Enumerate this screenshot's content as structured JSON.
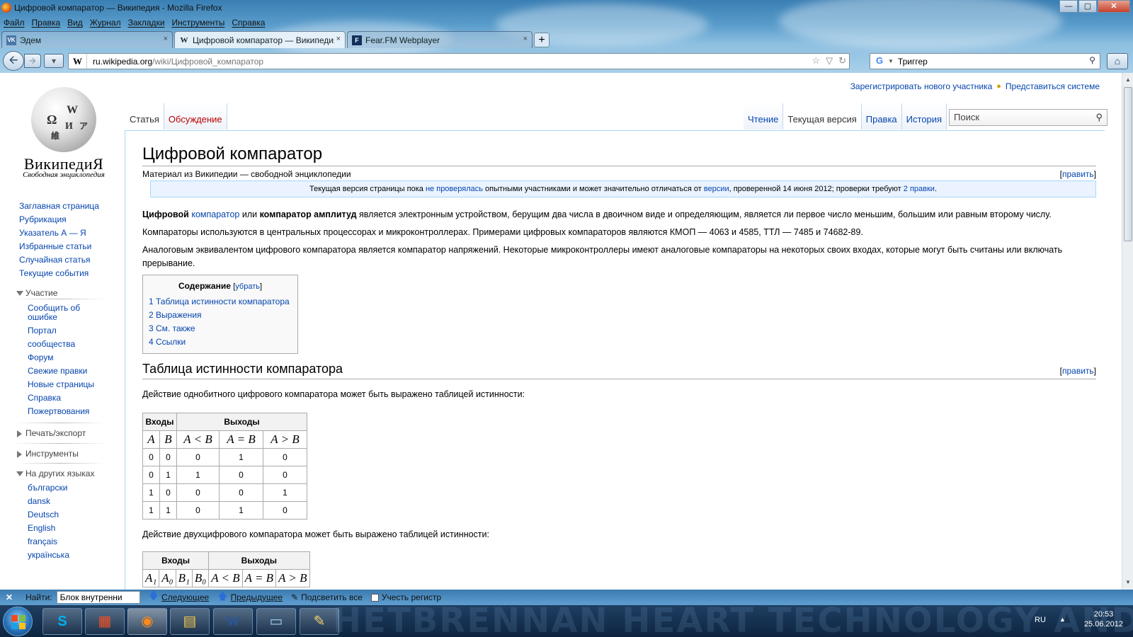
{
  "window": {
    "title": "Цифровой компаратор — Википедия - Mozilla Firefox",
    "controls": {
      "minimize": "—",
      "maximize": "▢",
      "close": "✕"
    }
  },
  "menu": [
    "Файл",
    "Правка",
    "Вид",
    "Журнал",
    "Закладки",
    "Инструменты",
    "Справка"
  ],
  "tabs": [
    {
      "label": "Эдем",
      "favicon": "vk-icon",
      "fav_glyph": "VK",
      "active": false
    },
    {
      "label": "Цифровой компаратор — Википедия",
      "favicon": "wikipedia-icon",
      "fav_glyph": "W",
      "active": true
    },
    {
      "label": "Fear.FM Webplayer",
      "favicon": "fearfm-icon",
      "fav_glyph": "F",
      "active": false
    }
  ],
  "new_tab": "+",
  "tab_close": "×",
  "navbar": {
    "url_domain": "ru.wikipedia.org",
    "url_path": "/wiki/Цифровой_компаратор",
    "url_favicon": "W",
    "search_value": "Триггер",
    "search_engine": "G",
    "back_icon": "back-arrow-icon",
    "forward_icon": "forward-arrow-icon"
  },
  "personal": {
    "register": "Зарегистрировать нового участника",
    "login": "Представиться системе"
  },
  "logo": {
    "title": "ВикипедиЯ",
    "subtitle": "Свободная энциклопедия",
    "glyphs": [
      "Ω",
      "W",
      "И",
      "維",
      "ア"
    ]
  },
  "view_tabs": {
    "left": [
      {
        "label": "Статья",
        "selected": true
      },
      {
        "label": "Обсуждение",
        "selected": false
      }
    ],
    "right": [
      {
        "label": "Чтение",
        "selected": false
      },
      {
        "label": "Текущая версия",
        "selected": true
      },
      {
        "label": "Правка",
        "selected": false
      },
      {
        "label": "История",
        "selected": false
      }
    ]
  },
  "wiki_search": {
    "placeholder": "Поиск"
  },
  "sidebar": {
    "nav": [
      "Заглавная страница",
      "Рубрикация",
      "Указатель А — Я",
      "Избранные статьи",
      "Случайная статья",
      "Текущие события"
    ],
    "participation": {
      "title": "Участие",
      "items": [
        "Сообщить об ошибке",
        "Портал сообщества",
        "Форум",
        "Свежие правки",
        "Новые страницы",
        "Справка",
        "Пожертвования"
      ]
    },
    "print_title": "Печать/экспорт",
    "tools_title": "Инструменты",
    "languages": {
      "title": "На других языках",
      "items": [
        "български",
        "dansk",
        "Deutsch",
        "English",
        "français",
        "українська"
      ]
    }
  },
  "article": {
    "title": "Цифровой компаратор",
    "sitesub": "Материал из Википедии — свободной энциклопедии",
    "edit_label": "править",
    "flagged": {
      "pre": "Текущая версия страницы пока ",
      "link1": "не проверялась",
      "mid": " опытными участниками и может значительно отличаться от ",
      "link2": "версии",
      "post": ", проверенной 14 июня 2012; проверки требуют ",
      "link3": "2 правки",
      "end": "."
    },
    "p1": {
      "b1": "Цифровой",
      "link": "компаратор",
      "t1": " или ",
      "b2": "компаратор амплитуд",
      "t2": " является электронным устройством, берущим два числа в двоичном виде и определяющим, является ли первое число меньшим, большим или равным второму числу."
    },
    "p2": "Компараторы используются в центральных процессорах и микроконтроллерах. Примерами цифровых компараторов являются КМОП — 4063 и 4585, ТТЛ — 7485 и 74682-89.",
    "p3": "Аналоговым эквивалентом цифрового компаратора является компаратор напряжений. Некоторые микроконтроллеры имеют аналоговые компараторы на некоторых своих входах, которые могут быть считаны или включать прерывание.",
    "toc": {
      "title": "Содержание",
      "toggle": "убрать",
      "items": [
        "1 Таблица истинности компаратора",
        "2 Выражения",
        "3 См. также",
        "4 Ссылки"
      ]
    },
    "h2_truth": "Таблица истинности компаратора",
    "p4": "Действие однобитного цифрового компаратора может быть выражено таблицей истинности:",
    "table1": {
      "group_in": "Входы",
      "group_out": "Выходы",
      "cols": [
        "A",
        "B",
        "A < B",
        "A = B",
        "A > B"
      ],
      "rows": [
        [
          "0",
          "0",
          "0",
          "1",
          "0"
        ],
        [
          "0",
          "1",
          "1",
          "0",
          "0"
        ],
        [
          "1",
          "0",
          "0",
          "0",
          "1"
        ],
        [
          "1",
          "1",
          "0",
          "1",
          "0"
        ]
      ]
    },
    "p5": "Действие двухцифрового компаратора может быть выражено таблицей истинности:",
    "table2": {
      "group_in": "Входы",
      "group_out": "Выходы",
      "cols": [
        "A₁",
        "A₀",
        "B₁",
        "B₀",
        "A < B",
        "A = B",
        "A > B"
      ]
    }
  },
  "findbar": {
    "label": "Найти:",
    "value": "Блок внутренни",
    "next": "Следующее",
    "prev": "Предыдущее",
    "highlight": "Подсветить все",
    "match_case": "Учесть регистр"
  },
  "taskbar": {
    "bg_text": "HETBRENNAN HEART TECHNOLOGY AND",
    "apps": [
      {
        "name": "skype",
        "glyph": "S"
      },
      {
        "name": "windows-live",
        "glyph": "▦"
      },
      {
        "name": "firefox",
        "glyph": "◉"
      },
      {
        "name": "explorer",
        "glyph": "▤"
      },
      {
        "name": "word",
        "glyph": "W"
      },
      {
        "name": "image-viewer",
        "glyph": "▭"
      },
      {
        "name": "paint",
        "glyph": "✎"
      }
    ],
    "lang": "RU",
    "time": "20:53",
    "date": "25.06.2012"
  }
}
